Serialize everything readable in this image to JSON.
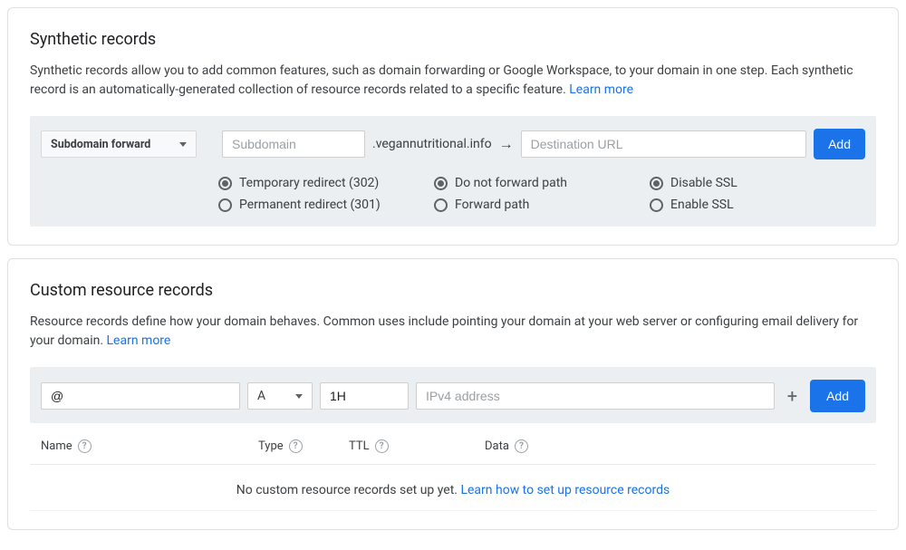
{
  "synthetic": {
    "title": "Synthetic records",
    "desc": "Synthetic records allow you to add common features, such as domain forwarding or Google Workspace, to your domain in one step. Each synthetic record is an automatically-generated collection of resource records related to a specific feature. ",
    "learn_more": "Learn more",
    "forward_type": "Subdomain forward",
    "subdomain_placeholder": "Subdomain",
    "domain_suffix": ".vegannutritional.info",
    "dest_placeholder": "Destination URL",
    "add_label": "Add",
    "radios": {
      "temp302": "Temporary redirect (302)",
      "perm301": "Permanent redirect (301)",
      "no_forward_path": "Do not forward path",
      "forward_path": "Forward path",
      "disable_ssl": "Disable SSL",
      "enable_ssl": "Enable SSL"
    }
  },
  "custom": {
    "title": "Custom resource records",
    "desc": "Resource records define how your domain behaves. Common uses include pointing your domain at your web server or configuring email delivery for your domain. ",
    "learn_more": "Learn more",
    "name_value": "@",
    "type_value": "A",
    "ttl_value": "1H",
    "data_placeholder": "IPv4 address",
    "add_label": "Add",
    "headers": {
      "name": "Name",
      "type": "Type",
      "ttl": "TTL",
      "data": "Data"
    },
    "empty_prefix": "No custom resource records set up yet. ",
    "empty_link": "Learn how to set up resource records"
  }
}
